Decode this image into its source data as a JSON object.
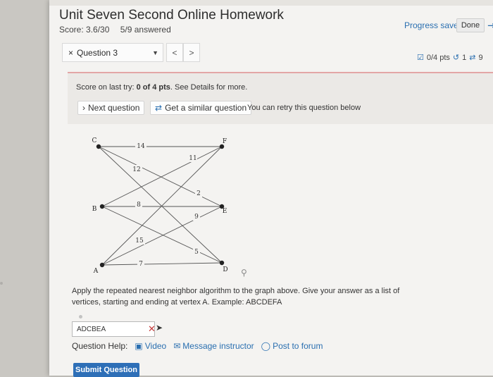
{
  "header": {
    "title": "Unit Seven Second Online Homework",
    "score": "Score: 3.6/30",
    "answered": "5/9 answered",
    "progress": "Progress saved",
    "done_label": "Done"
  },
  "nav": {
    "question_label": "Question 3",
    "close_glyph": "×",
    "prev_glyph": "<",
    "next_glyph": ">",
    "pts": "0/4 pts",
    "retries": "1",
    "similar_count": "9"
  },
  "feedback": {
    "score_prefix": "Score on last try: ",
    "score_value": "0 of 4 pts",
    "score_suffix": ". See Details for more.",
    "next_question": "Next question",
    "similar_question": "Get a similar question",
    "retry_text": "You can retry this question below"
  },
  "graph": {
    "vertices": {
      "A": "A",
      "B": "B",
      "C": "C",
      "D": "D",
      "E": "E",
      "F": "F"
    },
    "edge_labels": {
      "CF": "14",
      "CE": "12",
      "BF": "11",
      "AF": "2",
      "BE": "8",
      "AE": "9",
      "BD": "15",
      "CD": "5",
      "AD": "7"
    }
  },
  "question": {
    "prompt": "Apply the repeated nearest neighbor algorithm to the graph above. Give your answer as a list of vertices, starting and ending at vertex A. Example: ABCDEFA",
    "answer_value": "ADCBEA",
    "help_label": "Question Help:",
    "video": "Video",
    "message": "Message instructor",
    "forum": "Post to forum",
    "submit": "Submit Question"
  },
  "icons": {
    "exit": "exit-icon",
    "search": "search-icon",
    "video": "video-icon",
    "mail": "mail-icon",
    "forum": "forum-icon"
  },
  "colors": {
    "accent": "#2e6fb7",
    "link": "#2a6fb0",
    "error": "#c43a3a"
  }
}
